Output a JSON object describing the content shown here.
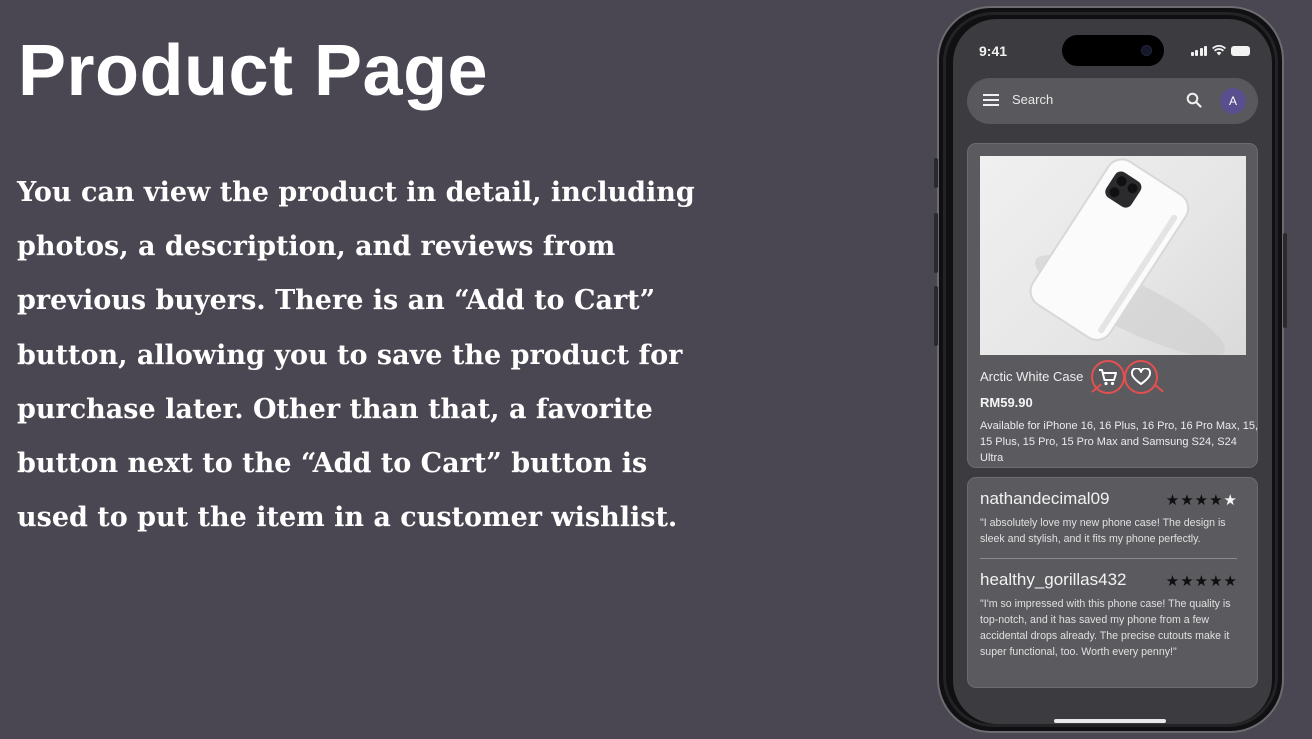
{
  "slide": {
    "title": "Product Page",
    "description": "You can view the product in detail, including photos, a description, and reviews from previous buyers. There is an “Add to Cart” button, allowing you to save the product for purchase later. Other than that, a favorite button next to the “Add to Cart” button is used to put the item in a customer wishlist."
  },
  "status_bar": {
    "time": "9:41"
  },
  "search": {
    "label": "Search",
    "avatar_initial": "A"
  },
  "product": {
    "name": "Arctic White Case",
    "price": "RM59.90",
    "availability": "Available for iPhone 16, 16 Plus, 16 Pro, 16 Pro Max, 15, 15 Plus, 15 Pro, 15 Pro Max and Samsung S24, S24 Ultra"
  },
  "reviews": [
    {
      "user": "nathandecimal09",
      "rating": 4,
      "stars": "★★★★★",
      "text": "\"I absolutely love my new phone case! The design is sleek and stylish, and it fits my phone perfectly."
    },
    {
      "user": "healthy_gorillas432",
      "rating": 5,
      "stars": "★★★★★",
      "text": "\"I'm so impressed with this phone case! The quality is top-notch, and it has saved my phone from a few accidental drops already. The precise cutouts make it super functional, too. Worth every penny!\""
    }
  ],
  "colors": {
    "background": "#4a4752",
    "highlight": "#e45050",
    "avatar": "#5a4f8e",
    "card": "#5b5a5f"
  },
  "icons": [
    "menu-icon",
    "search-icon",
    "cart-icon",
    "heart-icon",
    "star-icon",
    "signal-icon",
    "wifi-icon",
    "battery-icon"
  ]
}
